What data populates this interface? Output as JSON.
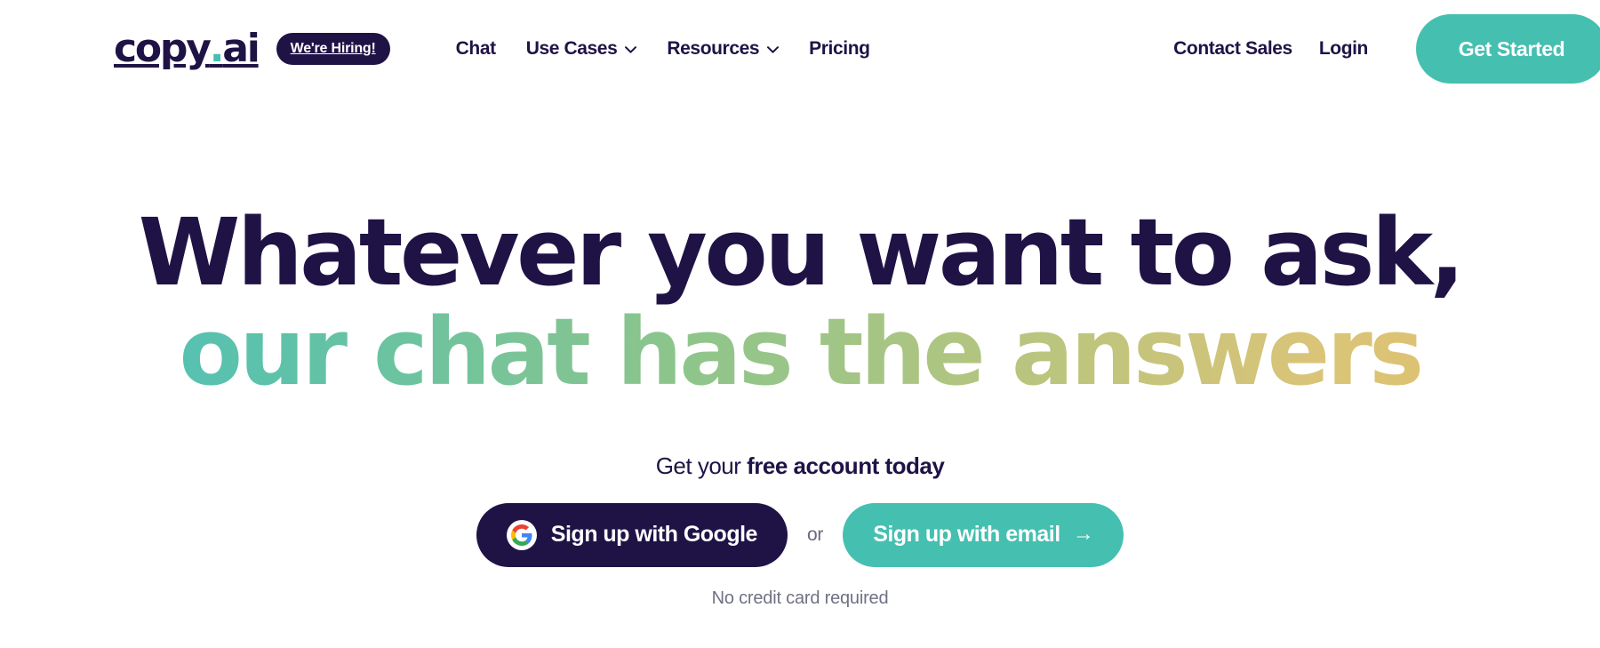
{
  "brand": {
    "logo_text_1": "copy",
    "logo_dot": ".",
    "logo_text_2": "ai",
    "accent_teal": "#45BFB0",
    "navy": "#1F1346"
  },
  "nav": {
    "hiring_badge": "We're Hiring!",
    "links": [
      {
        "label": "Chat",
        "has_dropdown": false
      },
      {
        "label": "Use Cases",
        "has_dropdown": true,
        "icon": "chevron-down-icon"
      },
      {
        "label": "Resources",
        "has_dropdown": true,
        "icon": "chevron-down-icon"
      },
      {
        "label": "Pricing",
        "has_dropdown": false
      }
    ],
    "contact_sales": "Contact Sales",
    "login": "Login",
    "get_started": "Get Started"
  },
  "hero": {
    "headline_line1": "Whatever you want to ask,",
    "headline_line2": "our chat has the answers",
    "subhead_regular": "Get your ",
    "subhead_bold": "free account today",
    "google_button": "Sign up with Google",
    "google_icon": "google-g-icon",
    "or_separator": "or",
    "email_button": "Sign up with email",
    "email_arrow_icon": "arrow-right-icon",
    "arrow_glyph": "→",
    "no_credit_card": "No credit card required"
  }
}
